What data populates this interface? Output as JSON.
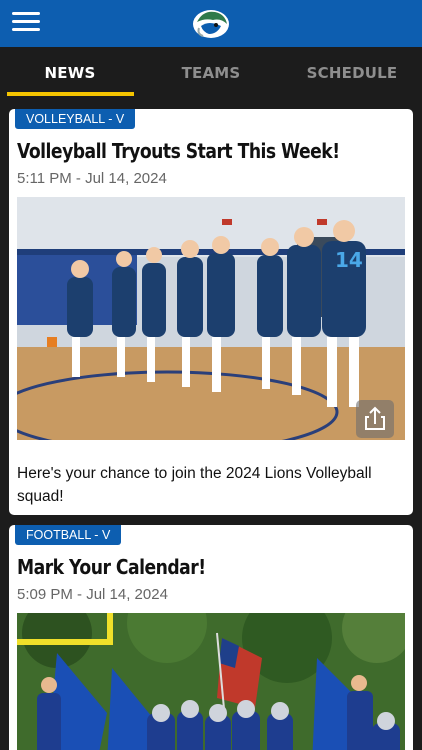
{
  "header": {
    "menu_icon": "hamburger-menu-icon",
    "logo": "lions-logo"
  },
  "tabs": [
    {
      "label": "NEWS",
      "active": true
    },
    {
      "label": "TEAMS",
      "active": false
    },
    {
      "label": "SCHEDULE",
      "active": false
    }
  ],
  "colors": {
    "header_blue": "#0d5eb0",
    "tab_underline": "#f5c400",
    "badge_blue": "#0d5eb0"
  },
  "articles": [
    {
      "badge": "VOLLEYBALL - V",
      "title": "Volleyball Tryouts Start This Week!",
      "date": "5:11 PM - Jul 14, 2024",
      "description": "Here's your chance to join the 2024 Lions Volleyball squad!",
      "share_icon": "share-icon"
    },
    {
      "badge": "FOOTBALL - V",
      "title": "Mark Your Calendar!",
      "date": "5:09 PM - Jul 14, 2024"
    }
  ]
}
